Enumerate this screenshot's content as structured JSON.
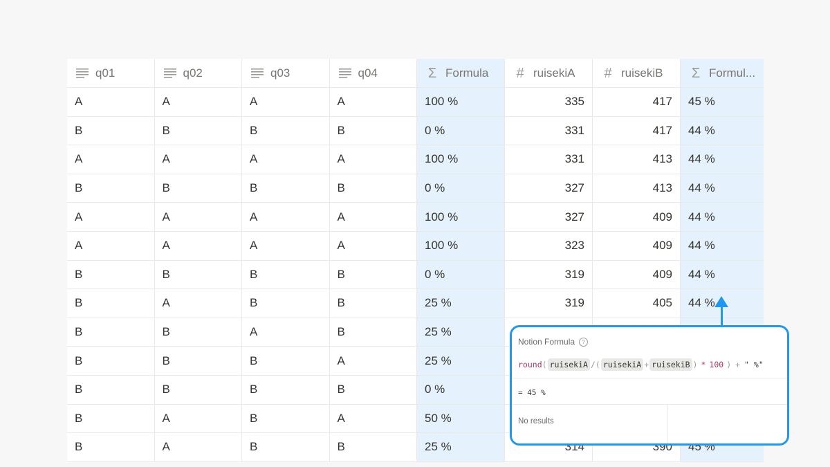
{
  "columns": [
    {
      "label": "q01",
      "icon": "text-lines-icon"
    },
    {
      "label": "q02",
      "icon": "text-lines-icon"
    },
    {
      "label": "q03",
      "icon": "text-lines-icon"
    },
    {
      "label": "q04",
      "icon": "text-lines-icon"
    },
    {
      "label": "Formula",
      "icon": "sigma-icon"
    },
    {
      "label": "ruisekiA",
      "icon": "hash-icon"
    },
    {
      "label": "ruisekiB",
      "icon": "hash-icon"
    },
    {
      "label": "Formul...",
      "icon": "sigma-icon"
    }
  ],
  "rows": [
    [
      "A",
      "A",
      "A",
      "A",
      "100 %",
      "335",
      "417",
      "45 %"
    ],
    [
      "B",
      "B",
      "B",
      "B",
      "0 %",
      "331",
      "417",
      "44 %"
    ],
    [
      "A",
      "A",
      "A",
      "A",
      "100 %",
      "331",
      "413",
      "44 %"
    ],
    [
      "B",
      "B",
      "B",
      "B",
      "0 %",
      "327",
      "413",
      "44 %"
    ],
    [
      "A",
      "A",
      "A",
      "A",
      "100 %",
      "327",
      "409",
      "44 %"
    ],
    [
      "A",
      "A",
      "A",
      "A",
      "100 %",
      "323",
      "409",
      "44 %"
    ],
    [
      "B",
      "B",
      "B",
      "B",
      "0 %",
      "319",
      "409",
      "44 %"
    ],
    [
      "B",
      "A",
      "B",
      "B",
      "25 %",
      "319",
      "405",
      "44 %"
    ],
    [
      "B",
      "B",
      "A",
      "B",
      "25 %",
      "",
      "",
      ""
    ],
    [
      "B",
      "B",
      "B",
      "A",
      "25 %",
      "",
      "",
      ""
    ],
    [
      "B",
      "B",
      "B",
      "B",
      "0 %",
      "",
      "",
      ""
    ],
    [
      "B",
      "A",
      "B",
      "A",
      "50 %",
      "",
      "",
      ""
    ],
    [
      "B",
      "A",
      "B",
      "B",
      "25 %",
      "314",
      "390",
      "45 %"
    ]
  ],
  "popup": {
    "title": "Notion Formula",
    "help": "?",
    "expr": {
      "fn": "round",
      "open1": "(",
      "varA": "ruisekiA",
      "div": "/",
      "open2": "(",
      "varA2": "ruisekiA",
      "plus": "+",
      "varB": "ruisekiB",
      "close2": ")",
      "mul": "*",
      "num": "100",
      "close1": ")",
      "plus2": "+",
      "str": "\" %\""
    },
    "result": "= 45 %",
    "no_results": "No results"
  },
  "accent_color": "#1e98f0"
}
